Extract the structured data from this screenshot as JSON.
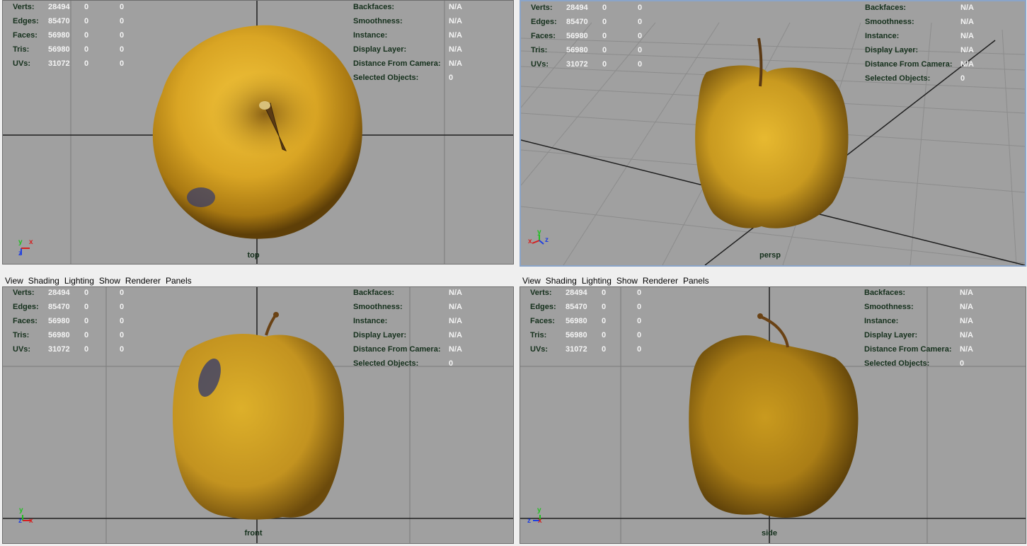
{
  "menu": [
    "View",
    "Shading",
    "Lighting",
    "Show",
    "Renderer",
    "Panels"
  ],
  "hud_left": {
    "labels": [
      "Verts:",
      "Edges:",
      "Faces:",
      "Tris:",
      "UVs:"
    ],
    "values": [
      [
        "28494",
        "0",
        "0"
      ],
      [
        "85470",
        "0",
        "0"
      ],
      [
        "56980",
        "0",
        "0"
      ],
      [
        "56980",
        "0",
        "0"
      ],
      [
        "31072",
        "0",
        "0"
      ]
    ]
  },
  "hud_right": {
    "labels": [
      "Backfaces:",
      "Smoothness:",
      "Instance:",
      "Display Layer:",
      "Distance From Camera:",
      "Selected Objects:"
    ],
    "values": [
      "N/A",
      "N/A",
      "N/A",
      "N/A",
      "N/A",
      "0"
    ]
  },
  "viewports": [
    {
      "camera": "top",
      "axes": [
        "y",
        "x",
        "z"
      ]
    },
    {
      "camera": "persp",
      "axes": [
        "x",
        "y",
        "z"
      ]
    },
    {
      "camera": "front",
      "axes": [
        "y",
        "z",
        "x"
      ]
    },
    {
      "camera": "side",
      "axes": [
        "y",
        "z",
        "x"
      ]
    }
  ],
  "colors": {
    "viewport_bg": "#a0a0a0",
    "apple_yellow": "#d4a321",
    "hud_label": "#15301c",
    "hud_value": "#f4f4f4",
    "axis_x": "#d42020",
    "axis_y": "#20c020",
    "axis_z": "#2040e0"
  }
}
